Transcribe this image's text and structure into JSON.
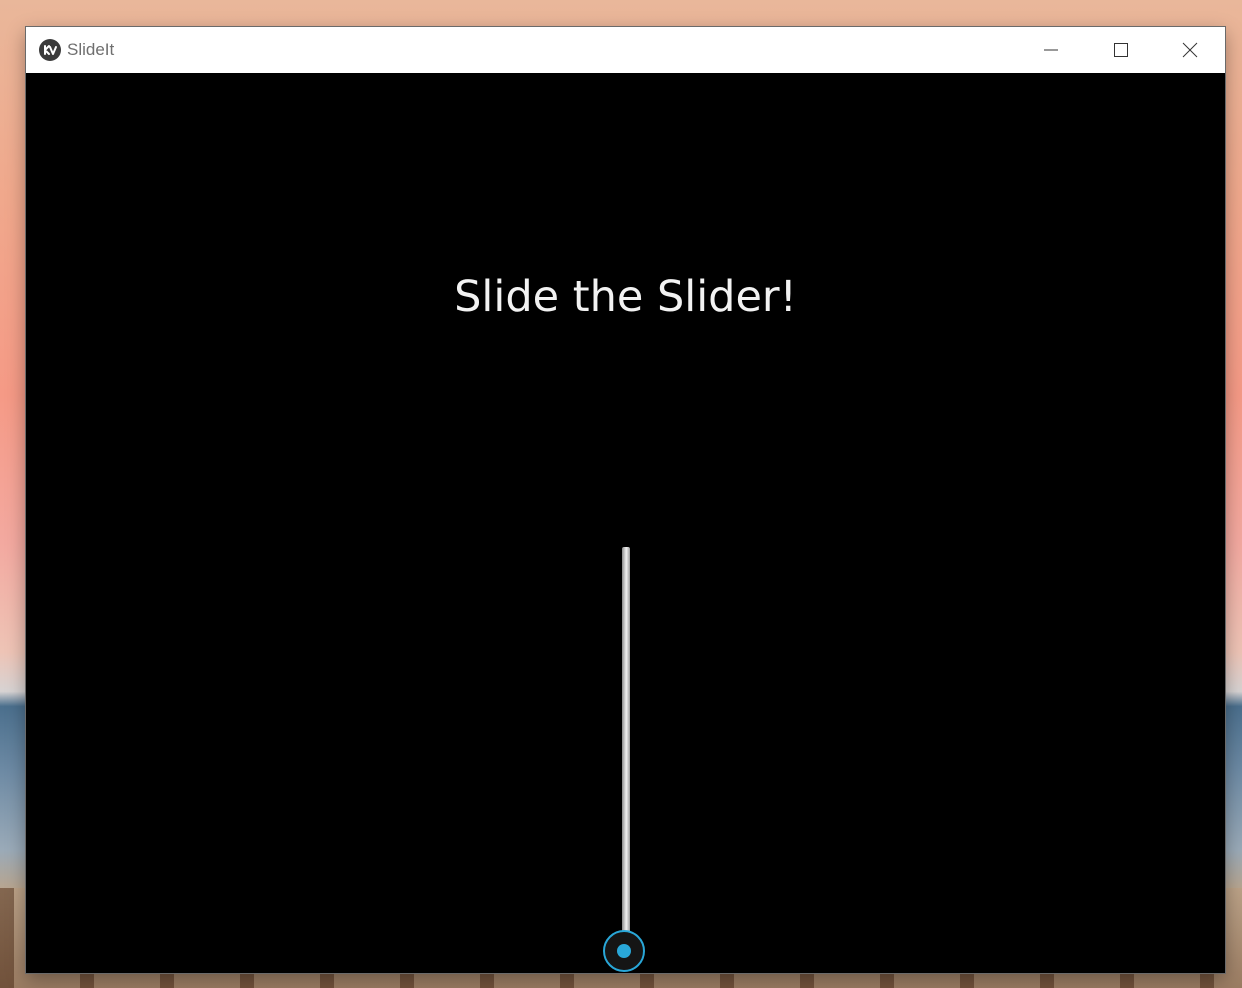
{
  "window": {
    "title": "SlideIt",
    "controls": {
      "minimize_icon": "minimize-icon",
      "maximize_icon": "maximize-icon",
      "close_icon": "close-icon"
    }
  },
  "content": {
    "headline": "Slide the Slider!"
  },
  "slider": {
    "orientation": "vertical",
    "value_fraction": 0.0,
    "accent_color": "#29a7d8"
  },
  "colors": {
    "content_background": "#000000",
    "headline_text": "#f2f2f2",
    "titlebar_background": "#ffffff"
  }
}
